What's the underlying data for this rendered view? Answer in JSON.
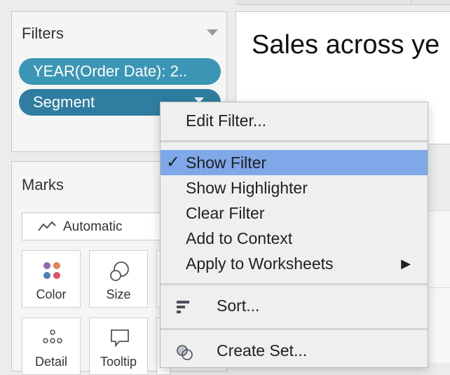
{
  "filters": {
    "title": "Filters",
    "pills": [
      {
        "label": "YEAR(Order Date): 2.."
      },
      {
        "label": "Segment"
      }
    ]
  },
  "marks": {
    "title": "Marks",
    "mark_type": "Automatic",
    "buttons": [
      {
        "label": "Color"
      },
      {
        "label": "Size"
      },
      {
        "label": "Detail"
      },
      {
        "label": "Tooltip"
      }
    ]
  },
  "sheet": {
    "title": "Sales across ye"
  },
  "context_menu": {
    "items": [
      {
        "label": "Edit Filter..."
      },
      {
        "label": "Show Filter",
        "checked": true,
        "check_mark": "✓"
      },
      {
        "label": "Show Highlighter"
      },
      {
        "label": "Clear Filter"
      },
      {
        "label": "Add to Context"
      },
      {
        "label": "Apply to Worksheets",
        "submenu_arrow": "▶"
      },
      {
        "label": "Sort..."
      },
      {
        "label": "Create Set..."
      }
    ]
  },
  "colors": {
    "pill_year": "#3b96b5",
    "pill_segment": "#2f7da0",
    "menu_highlight": "#7ea8e8"
  },
  "icons": {
    "sort": "sort-icon",
    "create_set": "create-set-icon",
    "mark_type": "line-chart-icon"
  }
}
